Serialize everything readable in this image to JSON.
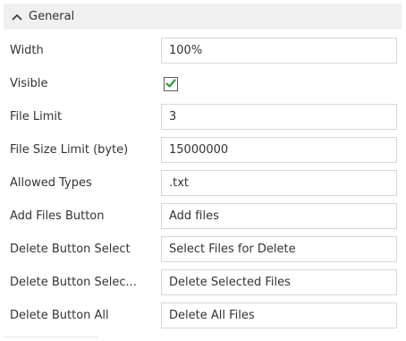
{
  "section": {
    "title": "General",
    "chevron_icon": "chevron-up-icon"
  },
  "properties": {
    "width": {
      "label": "Width",
      "value": "100%"
    },
    "visible": {
      "label": "Visible",
      "checked": true
    },
    "file_limit": {
      "label": "File Limit",
      "value": "3"
    },
    "file_size_limit": {
      "label": "File Size Limit (byte)",
      "value": "15000000"
    },
    "allowed_types": {
      "label": "Allowed Types",
      "value": ".txt"
    },
    "add_files_button": {
      "label": "Add Files Button",
      "value": "Add files"
    },
    "delete_button_select": {
      "label": "Delete Button Select",
      "value": "Select Files for Delete"
    },
    "delete_button_selected": {
      "label": "Delete Button Selec...",
      "value": "Delete Selected Files"
    },
    "delete_button_all": {
      "label": "Delete Button All",
      "value": "Delete All Files"
    }
  },
  "colors": {
    "header_bg": "#f0f0f0",
    "checkmark": "#2e9e3a",
    "input_border": "#d6d6d6"
  }
}
